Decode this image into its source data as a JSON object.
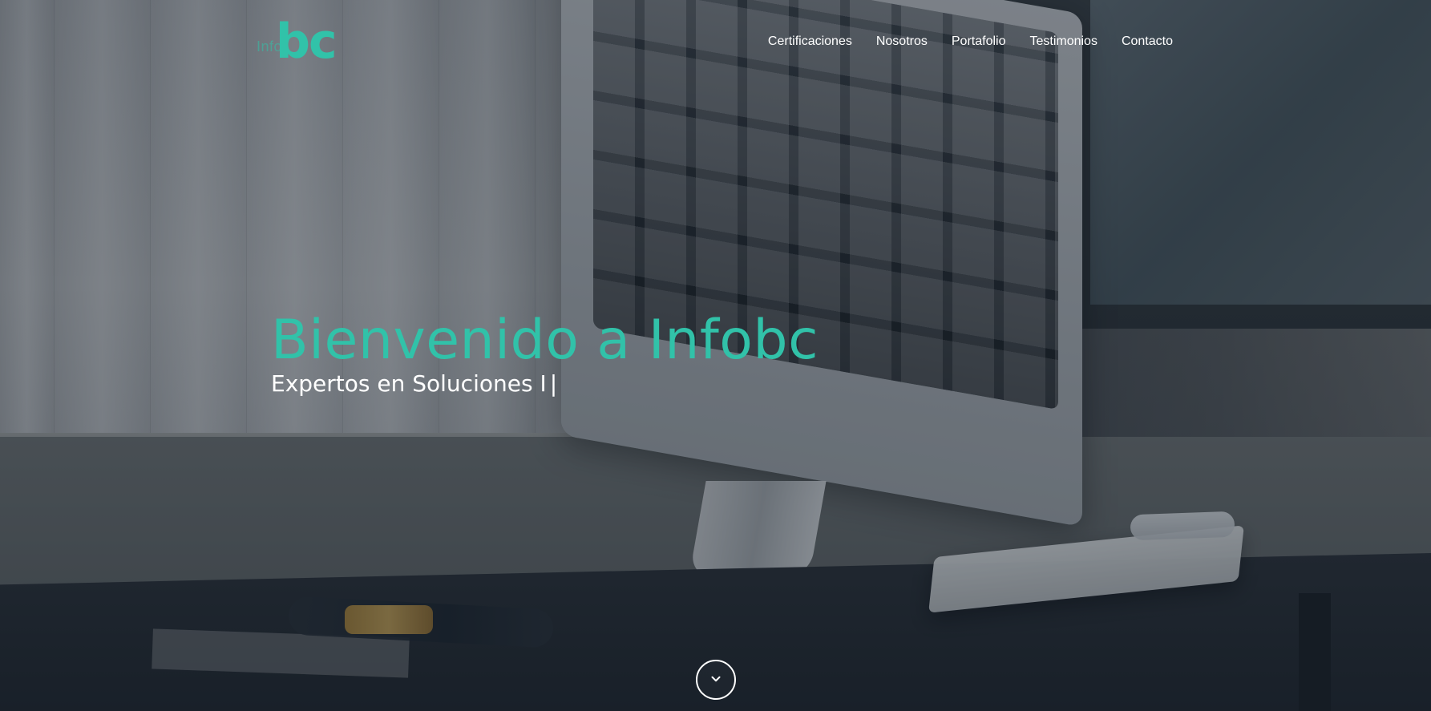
{
  "brand": {
    "logo_prefix": "Info",
    "logo_main": "bc",
    "accent_color": "#31c2a9"
  },
  "nav": {
    "items": [
      {
        "label": "Certificaciones"
      },
      {
        "label": "Nosotros"
      },
      {
        "label": "Portafolio"
      },
      {
        "label": "Testimonios"
      },
      {
        "label": "Contacto"
      }
    ]
  },
  "hero": {
    "title": "Bienvenido a Infobc",
    "subtitle": "Expertos en Soluciones I",
    "cursor": "|"
  },
  "icons": {
    "scroll_down": "chevron-down-icon"
  }
}
